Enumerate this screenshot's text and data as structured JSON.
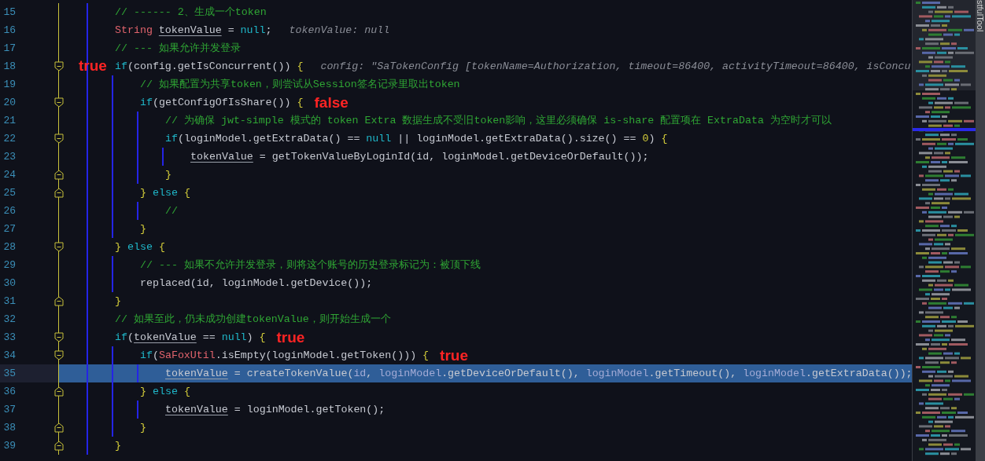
{
  "lines": [
    {
      "number": "15",
      "selected": false,
      "fold_start": false,
      "fold_end": false,
      "tokens": [
        {
          "kind": "comment",
          "text": "// ------ 2、生成一个token"
        }
      ]
    },
    {
      "number": "16",
      "selected": false,
      "fold_start": false,
      "fold_end": false,
      "tokens": [
        {
          "kind": "type",
          "text": "String "
        },
        {
          "kind": "var",
          "text": "tokenValue"
        },
        {
          "kind": "plain",
          "text": " = "
        },
        {
          "kind": "keyword",
          "text": "null"
        },
        {
          "kind": "plain",
          "text": ";"
        }
      ],
      "hint": "tokenValue: null"
    },
    {
      "number": "17",
      "selected": false,
      "fold_start": false,
      "fold_end": false,
      "tokens": [
        {
          "kind": "comment",
          "text": "// --- 如果允许并发登录"
        }
      ]
    },
    {
      "number": "18",
      "selected": false,
      "fold_start": true,
      "fold_end": false,
      "tokens": [
        {
          "kind": "keyword",
          "text": "if"
        },
        {
          "kind": "plain",
          "text": "(config.getIsConcurrent()) "
        },
        {
          "kind": "brace",
          "text": "{"
        }
      ],
      "hint": "config: \"SaTokenConfig [tokenName=Authorization, timeout=86400, activityTimeout=86400, isConcu",
      "annotation": {
        "kind": "gutter",
        "text": "true"
      },
      "children": [
        {
          "number": "19",
          "selected": false,
          "fold_start": false,
          "fold_end": false,
          "tokens": [
            {
              "kind": "comment",
              "text": "// 如果配置为共享token，则尝试从Session签名记录里取出token"
            }
          ]
        },
        {
          "number": "20",
          "selected": false,
          "fold_start": true,
          "fold_end": false,
          "tokens": [
            {
              "kind": "keyword",
              "text": "if"
            },
            {
              "kind": "plain",
              "text": "(getConfigOfIsShare()) "
            },
            {
              "kind": "brace",
              "text": "{"
            }
          ],
          "annotation": {
            "kind": "inline",
            "text": "false"
          },
          "children": [
            {
              "number": "21",
              "selected": false,
              "fold_start": false,
              "fold_end": false,
              "tokens": [
                {
                  "kind": "comment",
                  "text": "// 为确保 jwt-simple 模式的 token Extra 数据生成不受旧token影响，这里必须确保 is-share 配置项在 ExtraData 为空时才可以"
                }
              ]
            },
            {
              "number": "22",
              "selected": false,
              "fold_start": true,
              "fold_end": false,
              "tokens": [
                {
                  "kind": "keyword",
                  "text": "if"
                },
                {
                  "kind": "plain",
                  "text": "(loginModel.getExtraData() == "
                },
                {
                  "kind": "keyword",
                  "text": "null"
                },
                {
                  "kind": "plain",
                  "text": " || loginModel.getExtraData().size() == "
                },
                {
                  "kind": "number",
                  "text": "0"
                },
                {
                  "kind": "plain",
                  "text": ") "
                },
                {
                  "kind": "brace",
                  "text": "{"
                }
              ],
              "children": [
                {
                  "number": "23",
                  "selected": false,
                  "fold_start": false,
                  "fold_end": false,
                  "tokens": [
                    {
                      "kind": "var",
                      "text": "tokenValue"
                    },
                    {
                      "kind": "plain",
                      "text": " = getTokenValueByLoginId(id, loginModel.getDeviceOrDefault());"
                    }
                  ]
                }
              ]
            },
            {
              "number": "24",
              "selected": false,
              "fold_start": false,
              "fold_end": true,
              "tokens": [
                {
                  "kind": "brace",
                  "text": "}"
                }
              ]
            }
          ]
        },
        {
          "number": "25",
          "selected": false,
          "fold_start": false,
          "fold_end": true,
          "tokens": [
            {
              "kind": "brace",
              "text": "}"
            },
            {
              "kind": "keyword",
              "text": " else "
            },
            {
              "kind": "brace",
              "text": "{"
            }
          ],
          "children": [
            {
              "number": "26",
              "selected": false,
              "fold_start": false,
              "fold_end": false,
              "tokens": [
                {
                  "kind": "comment",
                  "text": "//"
                }
              ]
            }
          ]
        },
        {
          "number": "27",
          "selected": false,
          "fold_start": false,
          "fold_end": false,
          "tokens": [
            {
              "kind": "brace",
              "text": "}"
            }
          ]
        }
      ]
    },
    {
      "number": "28",
      "selected": false,
      "fold_start": true,
      "fold_end": false,
      "tokens": [
        {
          "kind": "brace",
          "text": "}"
        },
        {
          "kind": "keyword",
          "text": " else "
        },
        {
          "kind": "brace",
          "text": "{"
        }
      ],
      "children": [
        {
          "number": "29",
          "selected": false,
          "fold_start": false,
          "fold_end": false,
          "tokens": [
            {
              "kind": "comment",
              "text": "// --- 如果不允许并发登录，则将这个账号的历史登录标记为：被顶下线"
            }
          ]
        },
        {
          "number": "30",
          "selected": false,
          "fold_start": false,
          "fold_end": false,
          "tokens": [
            {
              "kind": "plain",
              "text": "replaced(id, loginModel.getDevice());"
            }
          ]
        }
      ]
    },
    {
      "number": "31",
      "selected": false,
      "fold_start": false,
      "fold_end": true,
      "tokens": [
        {
          "kind": "brace",
          "text": "}"
        }
      ]
    },
    {
      "number": "32",
      "selected": false,
      "fold_start": false,
      "fold_end": false,
      "tokens": [
        {
          "kind": "comment",
          "text": "// 如果至此，仍未成功创建tokenValue，则开始生成一个"
        }
      ]
    },
    {
      "number": "33",
      "selected": false,
      "fold_start": true,
      "fold_end": false,
      "tokens": [
        {
          "kind": "keyword",
          "text": "if"
        },
        {
          "kind": "plain",
          "text": "("
        },
        {
          "kind": "var",
          "text": "tokenValue"
        },
        {
          "kind": "plain",
          "text": " == "
        },
        {
          "kind": "keyword",
          "text": "null"
        },
        {
          "kind": "plain",
          "text": ") "
        },
        {
          "kind": "brace",
          "text": "{"
        }
      ],
      "annotation": {
        "kind": "inline",
        "text": "true"
      },
      "children": [
        {
          "number": "34",
          "selected": false,
          "fold_start": true,
          "fold_end": false,
          "tokens": [
            {
              "kind": "keyword",
              "text": "if"
            },
            {
              "kind": "plain",
              "text": "("
            },
            {
              "kind": "type",
              "text": "SaFoxUtil"
            },
            {
              "kind": "plain",
              "text": ".isEmpty(loginModel.getToken())) "
            },
            {
              "kind": "brace",
              "text": "{"
            }
          ],
          "annotation": {
            "kind": "inline",
            "text": "true"
          },
          "children": [
            {
              "number": "35",
              "selected": true,
              "fold_start": false,
              "fold_end": false,
              "tokens": [
                {
                  "kind": "var",
                  "text": "tokenValue"
                },
                {
                  "kind": "plain",
                  "text": " = createTokenValue("
                },
                {
                  "kind": "param",
                  "text": "id"
                },
                {
                  "kind": "plain",
                  "text": ", "
                },
                {
                  "kind": "param",
                  "text": "loginModel"
                },
                {
                  "kind": "plain",
                  "text": ".getDeviceOrDefault(), "
                },
                {
                  "kind": "param",
                  "text": "loginModel"
                },
                {
                  "kind": "plain",
                  "text": ".getTimeout(), "
                },
                {
                  "kind": "param",
                  "text": "loginModel"
                },
                {
                  "kind": "plain",
                  "text": ".getExtraData());"
                }
              ]
            }
          ]
        },
        {
          "number": "36",
          "selected": false,
          "fold_start": false,
          "fold_end": true,
          "tokens": [
            {
              "kind": "brace",
              "text": "}"
            },
            {
              "kind": "keyword",
              "text": " else "
            },
            {
              "kind": "brace",
              "text": "{"
            }
          ],
          "children": [
            {
              "number": "37",
              "selected": false,
              "fold_start": false,
              "fold_end": false,
              "tokens": [
                {
                  "kind": "var",
                  "text": "tokenValue"
                },
                {
                  "kind": "plain",
                  "text": " = loginModel.getToken();"
                }
              ]
            }
          ]
        },
        {
          "number": "38",
          "selected": false,
          "fold_start": false,
          "fold_end": true,
          "tokens": [
            {
              "kind": "brace",
              "text": "}"
            }
          ]
        }
      ]
    },
    {
      "number": "39",
      "selected": false,
      "fold_start": false,
      "fold_end": true,
      "tokens": [
        {
          "kind": "brace",
          "text": "}"
        }
      ]
    }
  ],
  "tool_window_tab": "stfulTool"
}
